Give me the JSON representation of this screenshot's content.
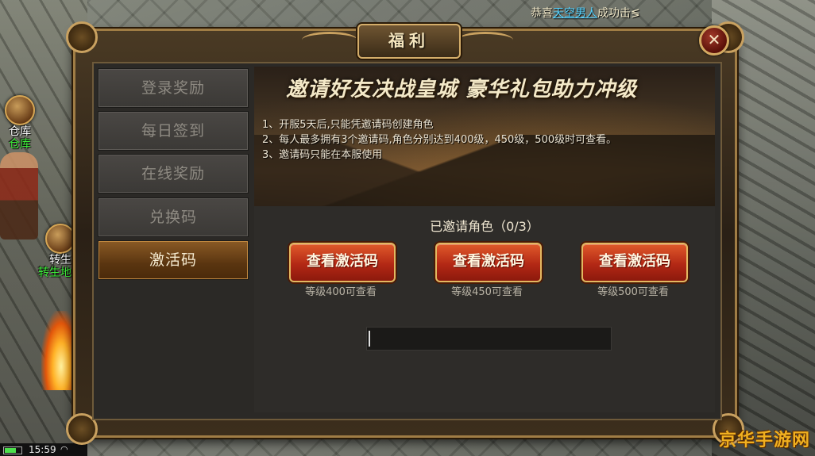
{
  "broadcast": {
    "prefix": "恭喜",
    "name": "天空男人",
    "suffix": "成功击≶"
  },
  "hud": {
    "warehouse_title": "仓库",
    "warehouse_label": "仓库",
    "rebirth_title": "转生",
    "rebirth_label": "转生地图"
  },
  "status_bar": {
    "time": "15:59"
  },
  "watermark": "京华手游网",
  "panel": {
    "title": "福利",
    "close_icon": "close-icon"
  },
  "sidebar": {
    "items": [
      {
        "label": "登录奖励",
        "active": false
      },
      {
        "label": "每日签到",
        "active": false
      },
      {
        "label": "在线奖励",
        "active": false
      },
      {
        "label": "兑换码",
        "active": false
      },
      {
        "label": "激活码",
        "active": true
      }
    ]
  },
  "banner": {
    "title": "邀请好友决战皇城  豪华礼包助力冲级",
    "rules": [
      "1、开服5天后,只能凭邀请码创建角色",
      "2、每人最多拥有3个邀请码,角色分别达到400级，450级，500级时可查看。",
      "3、邀请码只能在本服使用"
    ]
  },
  "invite": {
    "status": "已邀请角色（0/3）",
    "buttons": [
      {
        "label": "查看激活码",
        "note": "等级400可查看"
      },
      {
        "label": "查看激活码",
        "note": "等级450可查看"
      },
      {
        "label": "查看激活码",
        "note": "等级500可查看"
      }
    ]
  },
  "code_input": {
    "value": "",
    "placeholder": ""
  },
  "colors": {
    "accent_gold": "#c9a160",
    "button_red": "#b32815",
    "active_tab": "#8a5a25",
    "highlight_name": "#56d3ff",
    "green_label": "#3ef13a"
  }
}
